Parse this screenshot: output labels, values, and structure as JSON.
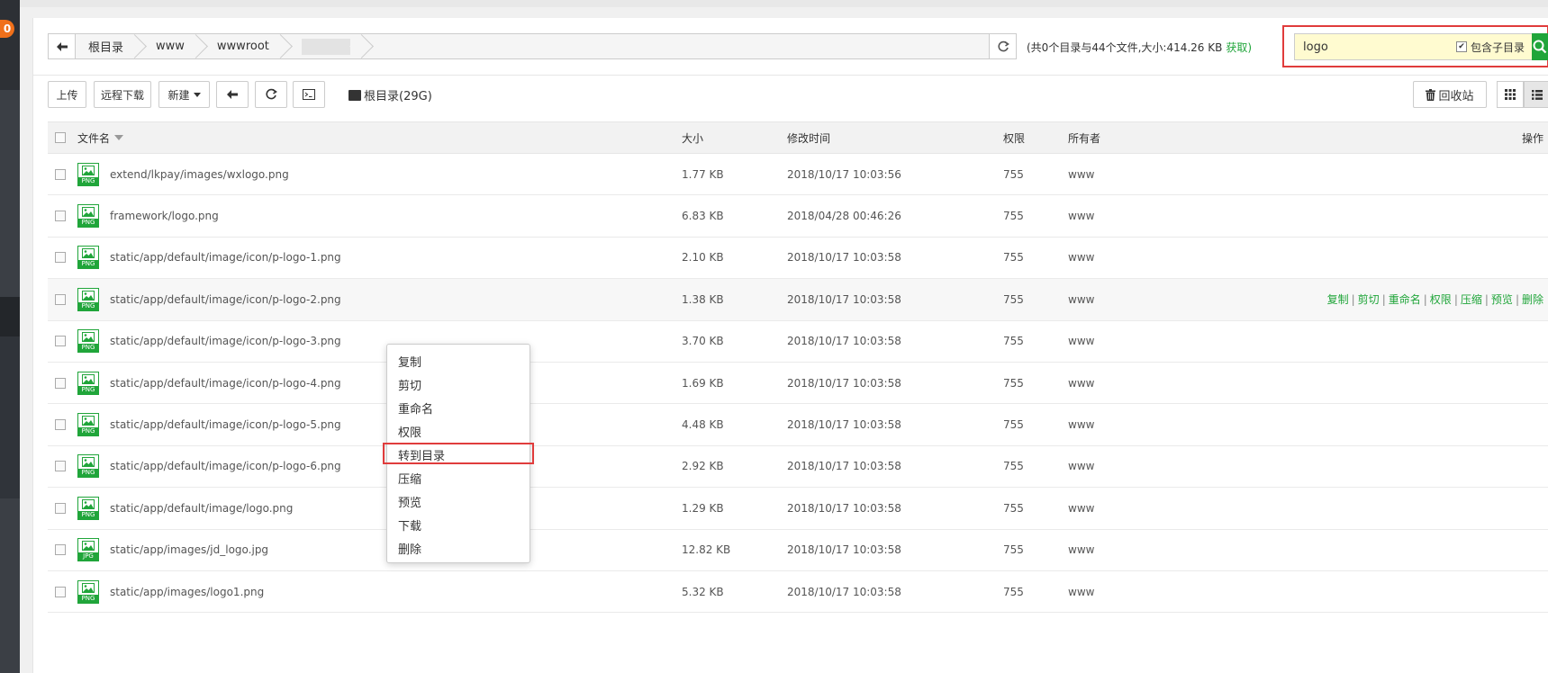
{
  "sidebar": {
    "badge": "0"
  },
  "path": {
    "crumbs": [
      "根目录",
      "www",
      "wwwroot"
    ],
    "summary": "(共0个目录与44个文件,大小:414.26 KB",
    "fetch_label": "获取)"
  },
  "search": {
    "value": "logo",
    "subdir_label": "包含子目录",
    "subdir_checked": true
  },
  "toolbar": {
    "upload": "上传",
    "remote_download": "远程下载",
    "new": "新建",
    "disk": "根目录(29G)",
    "recycle": "回收站"
  },
  "table": {
    "headers": {
      "name": "文件名",
      "size": "大小",
      "mtime": "修改时间",
      "perm": "权限",
      "owner": "所有者",
      "ops": "操作"
    },
    "rows": [
      {
        "name": "extend/lkpay/images/wxlogo.png",
        "ext": "PNG",
        "size": "1.77 KB",
        "mtime": "2018/10/17 10:03:56",
        "perm": "755",
        "owner": "www"
      },
      {
        "name": "framework/logo.png",
        "ext": "PNG",
        "size": "6.83 KB",
        "mtime": "2018/04/28 00:46:26",
        "perm": "755",
        "owner": "www"
      },
      {
        "name": "static/app/default/image/icon/p-logo-1.png",
        "ext": "PNG",
        "size": "2.10 KB",
        "mtime": "2018/10/17 10:03:58",
        "perm": "755",
        "owner": "www"
      },
      {
        "name": "static/app/default/image/icon/p-logo-2.png",
        "ext": "PNG",
        "size": "1.38 KB",
        "mtime": "2018/10/17 10:03:58",
        "perm": "755",
        "owner": "www"
      },
      {
        "name": "static/app/default/image/icon/p-logo-3.png",
        "ext": "PNG",
        "size": "3.70 KB",
        "mtime": "2018/10/17 10:03:58",
        "perm": "755",
        "owner": "www"
      },
      {
        "name": "static/app/default/image/icon/p-logo-4.png",
        "ext": "PNG",
        "size": "1.69 KB",
        "mtime": "2018/10/17 10:03:58",
        "perm": "755",
        "owner": "www"
      },
      {
        "name": "static/app/default/image/icon/p-logo-5.png",
        "ext": "PNG",
        "size": "4.48 KB",
        "mtime": "2018/10/17 10:03:58",
        "perm": "755",
        "owner": "www"
      },
      {
        "name": "static/app/default/image/icon/p-logo-6.png",
        "ext": "PNG",
        "size": "2.92 KB",
        "mtime": "2018/10/17 10:03:58",
        "perm": "755",
        "owner": "www"
      },
      {
        "name": "static/app/default/image/logo.png",
        "ext": "PNG",
        "size": "1.29 KB",
        "mtime": "2018/10/17 10:03:58",
        "perm": "755",
        "owner": "www"
      },
      {
        "name": "static/app/images/jd_logo.jpg",
        "ext": "JPG",
        "size": "12.82 KB",
        "mtime": "2018/10/17 10:03:58",
        "perm": "755",
        "owner": "www"
      },
      {
        "name": "static/app/images/logo1.png",
        "ext": "PNG",
        "size": "5.32 KB",
        "mtime": "2018/10/17 10:03:58",
        "perm": "755",
        "owner": "www"
      }
    ],
    "hover_ops": [
      "复制",
      "剪切",
      "重命名",
      "权限",
      "压缩",
      "预览",
      "删除"
    ]
  },
  "context_menu": {
    "items": [
      "复制",
      "剪切",
      "重命名",
      "权限",
      "转到目录",
      "压缩",
      "预览",
      "下载",
      "删除"
    ]
  },
  "colors": {
    "accent": "#20a53a",
    "highlight": "#e03c3c",
    "search_bg": "#fffbd0"
  }
}
